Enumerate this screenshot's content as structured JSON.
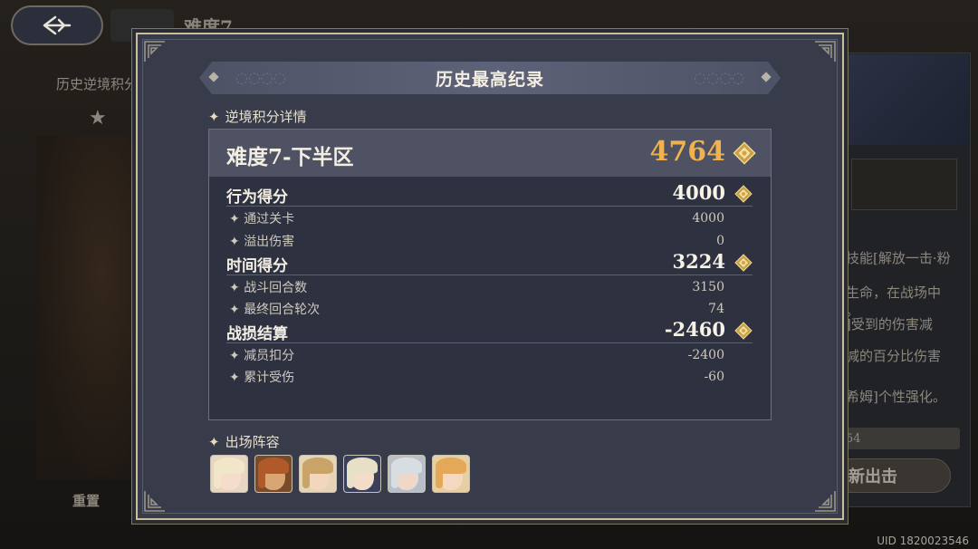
{
  "background": {
    "screen_title": "难度7",
    "subtitle": "历史逆境积分",
    "reset_label": "重置",
    "desc_lines": [
      "技能[解放一击·粉",
      "生命，在战场中",
      "。",
      "]受到的伤害减",
      "减的百分比伤害",
      "希姆]个性强化。"
    ],
    "score_strip_text": "54",
    "start_button_partial": "新出击",
    "uid_text": "UID 1820023546"
  },
  "modal": {
    "title": "历史最高纪录",
    "section_detail_label": "逆境积分详情",
    "difficulty_label": "难度7-下半区",
    "total_score": "4764",
    "score_groups": [
      {
        "label": "行为得分",
        "value": "4000",
        "items": [
          {
            "label": "通过关卡",
            "value": "4000"
          },
          {
            "label": "溢出伤害",
            "value": "0"
          }
        ]
      },
      {
        "label": "时间得分",
        "value": "3224",
        "items": [
          {
            "label": "战斗回合数",
            "value": "3150"
          },
          {
            "label": "最终回合轮次",
            "value": "74"
          }
        ]
      },
      {
        "label": "战损结算",
        "value": "-2460",
        "items": [
          {
            "label": "减员扣分",
            "value": "-2400"
          },
          {
            "label": "累计受伤",
            "value": "-60"
          }
        ]
      }
    ],
    "lineup_label": "出场阵容",
    "lineup": [
      {
        "name": "character-1",
        "bg": "#e7d7c2",
        "hair": "#f1e6c8",
        "skin": "#f5dccb"
      },
      {
        "name": "character-2",
        "bg": "#7a4b2a",
        "hair": "#b05a2c",
        "skin": "#d8a574"
      },
      {
        "name": "character-3",
        "bg": "#e4d4b8",
        "hair": "#c8a468",
        "skin": "#f2d6bd"
      },
      {
        "name": "character-4",
        "bg": "#3a3f5c",
        "hair": "#e8dfc8",
        "skin": "#f3ddc8"
      },
      {
        "name": "character-5",
        "bg": "#b7c0c8",
        "hair": "#d8dde2",
        "skin": "#efd8c8"
      },
      {
        "name": "character-6",
        "bg": "#e8cfa2",
        "hair": "#e3a858",
        "skin": "#f5d8bf"
      }
    ]
  },
  "colors": {
    "accent_gold": "#f0b24e",
    "gem_gold": "#d9b35a",
    "modal_border": "#cbbf9a"
  },
  "icons": {
    "back": "back-arrow-icon",
    "score": "diamond-gem-icon",
    "sparkle": "sparkle-icon"
  }
}
